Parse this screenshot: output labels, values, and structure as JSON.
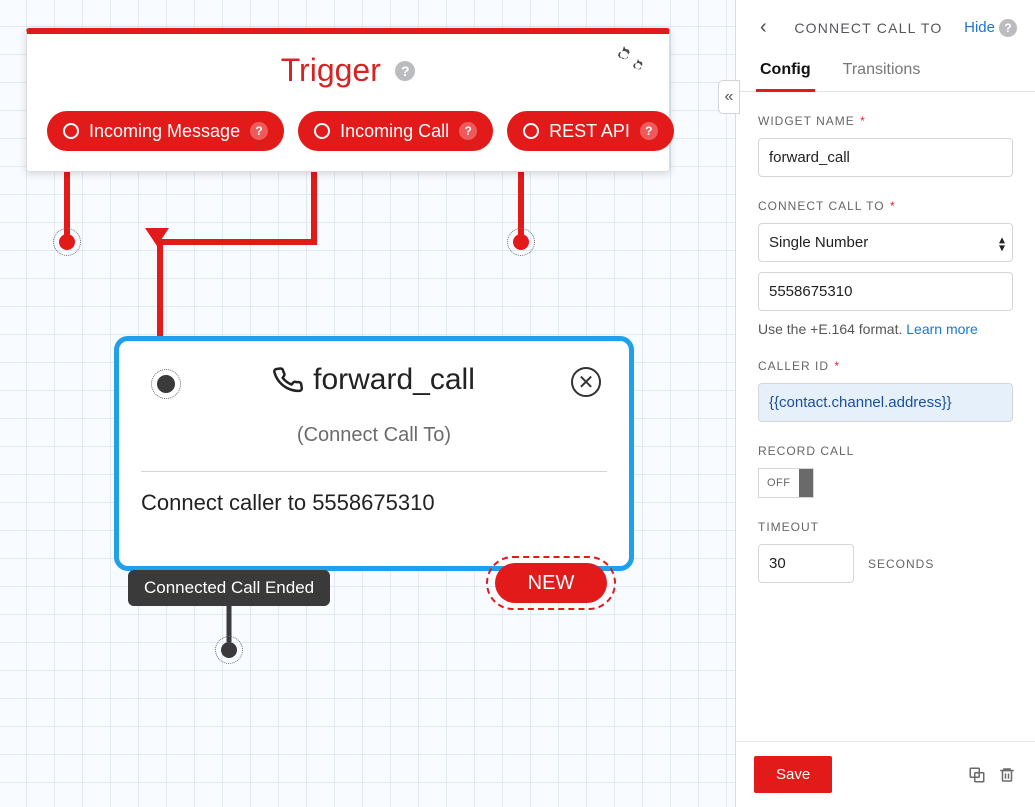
{
  "canvas": {
    "trigger": {
      "title": "Trigger",
      "pills": [
        {
          "label": "Incoming Message"
        },
        {
          "label": "Incoming Call"
        },
        {
          "label": "REST API"
        }
      ]
    },
    "widget": {
      "name": "forward_call",
      "subtitle": "(Connect Call To)",
      "description": "Connect caller to 5558675310",
      "outputs": [
        {
          "label": "Connected Call Ended"
        }
      ],
      "new_label": "NEW"
    }
  },
  "panel": {
    "title": "CONNECT CALL TO",
    "hide_label": "Hide",
    "tabs": {
      "config": "Config",
      "transitions": "Transitions"
    },
    "fields": {
      "widget_name": {
        "label": "WIDGET NAME",
        "value": "forward_call"
      },
      "connect_to": {
        "label": "CONNECT CALL TO",
        "select": "Single Number",
        "number": "5558675310",
        "hint_pre": "Use the +E.164 format. ",
        "hint_link": "Learn more"
      },
      "caller_id": {
        "label": "CALLER ID",
        "value": "{{contact.channel.address}}"
      },
      "record": {
        "label": "RECORD CALL",
        "state": "OFF"
      },
      "timeout": {
        "label": "TIMEOUT",
        "value": "30",
        "units": "SECONDS"
      }
    },
    "save_label": "Save"
  }
}
